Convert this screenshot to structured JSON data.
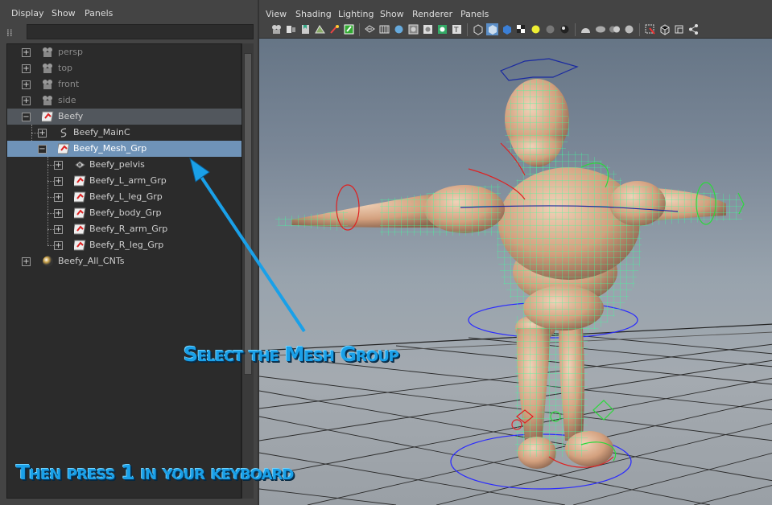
{
  "outliner": {
    "menu": [
      "Display",
      "Show",
      "Panels"
    ],
    "items": [
      {
        "label": "persp",
        "icon": "camera-icon"
      },
      {
        "label": "top",
        "icon": "camera-icon"
      },
      {
        "label": "front",
        "icon": "camera-icon"
      },
      {
        "label": "side",
        "icon": "camera-icon"
      },
      {
        "label": "Beefy",
        "icon": "group-icon"
      },
      {
        "label": "Beefy_MainC",
        "icon": "curve-icon"
      },
      {
        "label": "Beefy_Mesh_Grp",
        "icon": "group-icon"
      },
      {
        "label": "Beefy_pelvis",
        "icon": "mesh-icon"
      },
      {
        "label": "Beefy_L_arm_Grp",
        "icon": "group-icon"
      },
      {
        "label": "Beefy_L_leg_Grp",
        "icon": "group-icon"
      },
      {
        "label": "Beefy_body_Grp",
        "icon": "group-icon"
      },
      {
        "label": "Beefy_R_arm_Grp",
        "icon": "group-icon"
      },
      {
        "label": "Beefy_R_leg_Grp",
        "icon": "group-icon"
      },
      {
        "label": "Beefy_All_CNTs",
        "icon": "sphere-icon"
      }
    ],
    "selected": "Beefy_Mesh_Grp"
  },
  "viewport": {
    "menu": [
      "View",
      "Shading",
      "Lighting",
      "Show",
      "Renderer",
      "Panels"
    ]
  },
  "annotations": {
    "select_caption": "Select the Mesh Group",
    "press_caption": "Then press 1 in your keyboard"
  },
  "colors": {
    "selection": "#6f93b8",
    "wireframe": "#3dff9e",
    "skin": "#d9a888",
    "arrow": "#1aa0e8"
  }
}
